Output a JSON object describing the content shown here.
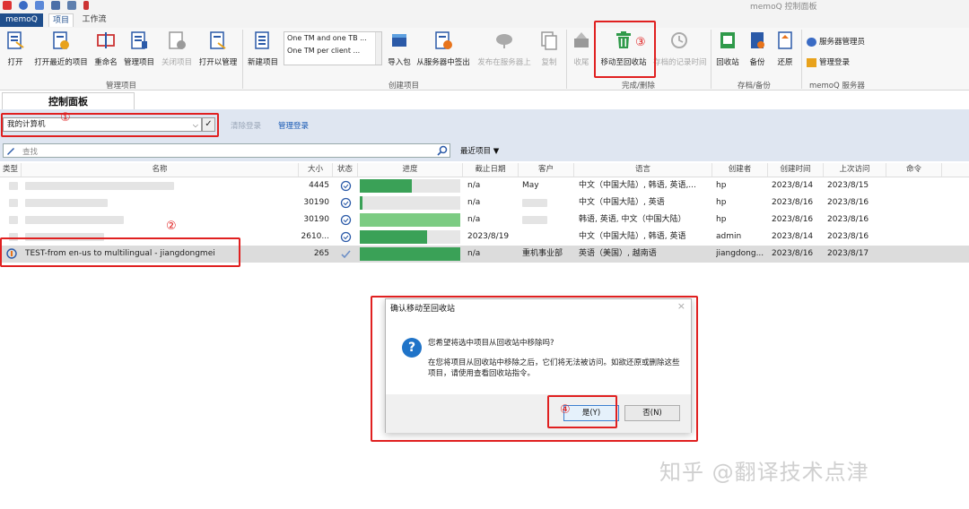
{
  "app": {
    "title": "memoQ 控制面板",
    "tabs": [
      "memoQ",
      "项目",
      "工作流"
    ]
  },
  "ribbon": {
    "buttons": {
      "open": "打开",
      "open_recent": "打开最近的项目",
      "rename": "重命名",
      "manage": "管理项目",
      "close": "关闭项目",
      "open_manage": "打开以管理",
      "new_project": "新建项目",
      "import": "导入包",
      "checkout": "从服务器中签出",
      "publish": "发布在服务器上",
      "copy": "复制",
      "archive": "收尾",
      "move_to_recycle": "移动至回收站",
      "archived_time": "存档的记录时间",
      "recycle_bin": "回收站",
      "backup": "备份",
      "restore": "还原",
      "server_admin": "服务器管理员",
      "admin_login": "管理登录"
    },
    "templates": [
      "One TM and one TB ...",
      "One TM per client ..."
    ],
    "groups": {
      "manage": "管理项目",
      "create": "创建项目",
      "finish": "完成/删除",
      "archive": "存档/备份",
      "server": "memoQ 服务器"
    }
  },
  "panel": {
    "tab_label": "控制面板",
    "computer_select": "我的计算机",
    "ok_symbol": "✓",
    "clear_login": "清除登录",
    "manage_login": "管理登录",
    "search_placeholder": "查找",
    "recent_projects": "最近项目"
  },
  "table": {
    "columns": [
      "类型",
      "名称",
      "大小",
      "状态",
      "进度",
      "截止日期",
      "客户",
      "语言",
      "创建者",
      "创建时间",
      "上次访问",
      "命令"
    ],
    "rows": [
      {
        "name": "",
        "size": "4445",
        "progress": 0.52,
        "progress_color": "#3aa157",
        "deadline": "n/a",
        "client": "May",
        "languages": "中文（中国大陆）, 韩语, 英语,...",
        "creator": "hp",
        "created": "2023/8/14",
        "accessed": "2023/8/15"
      },
      {
        "name": "",
        "size": "30190",
        "progress": 0.03,
        "progress_color": "#3aa157",
        "deadline": "n/a",
        "client": "",
        "languages": "中文（中国大陆）, 英语",
        "creator": "hp",
        "created": "2023/8/16",
        "accessed": "2023/8/16"
      },
      {
        "name": "",
        "size": "30190",
        "progress": 1.0,
        "progress_color": "#7ccc83",
        "deadline": "n/a",
        "client": "",
        "languages": "韩语, 英语, 中文（中国大陆）",
        "creator": "hp",
        "created": "2023/8/16",
        "accessed": "2023/8/16"
      },
      {
        "name": "",
        "size": "2610...",
        "progress": 0.67,
        "progress_color": "#3aa157",
        "deadline": "2023/8/19",
        "client": "",
        "languages": "中文（中国大陆）, 韩语, 英语",
        "creator": "admin",
        "created": "2023/8/14",
        "accessed": "2023/8/16"
      },
      {
        "name": "TEST-from en-us to multilingual - jiangdongmei",
        "size": "265",
        "progress": 1.0,
        "progress_color": "#3aa157",
        "deadline": "n/a",
        "client": "重机事业部",
        "languages": "英语（美国）, 越南语",
        "creator": "jiangdong...",
        "created": "2023/8/16",
        "accessed": "2023/8/17"
      }
    ]
  },
  "dialog": {
    "title": "确认移动至回收站",
    "close_symbol": "×",
    "question_symbol": "?",
    "message": "您希望将选中项目从回收站中移除吗?",
    "detail": "在您将项目从回收站中移除之后，它们将无法被访问。如欲还原或删除这些项目，请使用查看回收站指令。",
    "yes": "是(Y)",
    "no": "否(N)"
  },
  "annotations": [
    "①",
    "②",
    "③",
    "④"
  ],
  "watermark": "知乎 @翻译技术点津",
  "colors": {
    "brand_blue": "#1f4e8c",
    "annotation_red": "#e02020",
    "progress_green": "#3aa157",
    "progress_light_green": "#7ccc83",
    "link_blue": "#1a5bb5"
  }
}
